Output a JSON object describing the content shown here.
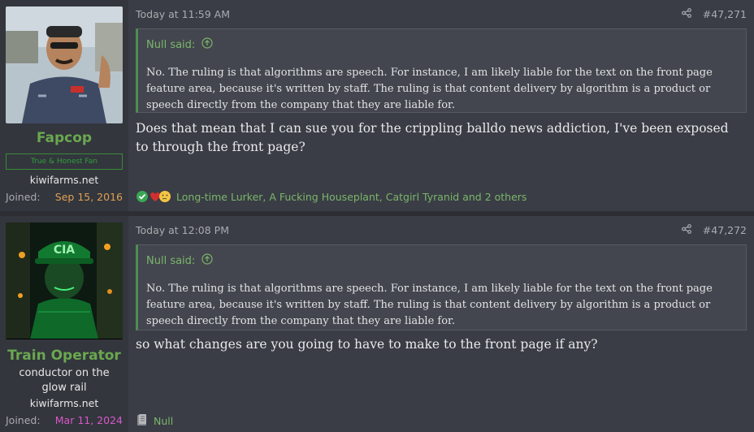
{
  "posts": [
    {
      "username": "Fapcop",
      "badge": "True & Honest Fan",
      "site": "kiwifarms.net",
      "joined_label": "Joined:",
      "joined_date": "Sep 15, 2016",
      "joined_color": "#e0a052",
      "timestamp": "Today at 11:59 AM",
      "post_number": "#47,271",
      "quote_author": "Null said:",
      "quote_text": "No. The ruling is that algorithms are speech. For instance, I am likely liable for the text on the front page feature area, because it's written by staff. The ruling is that content delivery by algorithm is a product or speech directly from the company that they are liable for.",
      "message": "Does that mean that I can sue you for the crippling balldo news addiction, I've been exposed to through the front page?",
      "reactions": "Long-time Lurker, A Fucking Houseplant, Catgirl Tyranid and 2 others"
    },
    {
      "username": "Train Operator",
      "user_title": "conductor on the glow rail",
      "site": "kiwifarms.net",
      "joined_label": "Joined:",
      "joined_date": "Mar 11, 2024",
      "joined_color": "#d957c9",
      "timestamp": "Today at 12:08 PM",
      "post_number": "#47,272",
      "quote_author": "Null said:",
      "quote_text": "No. The ruling is that algorithms are speech. For instance, I am likely liable for the text on the front page feature area, because it's written by staff. The ruling is that content delivery by algorithm is a product or speech directly from the company that they are liable for.",
      "message": "so what changes are you going to have to make to the front page if any?",
      "reactions": "Null"
    }
  ],
  "colors": {
    "accent_green": "#6aa84f",
    "quote_border": "#4b8f4e",
    "background": "#3a3d45"
  },
  "icons": [
    "share-icon",
    "up-arrow-icon",
    "checkmark-reaction-icon",
    "heart-reaction-icon",
    "thinking-reaction-icon",
    "file-reaction-icon"
  ]
}
